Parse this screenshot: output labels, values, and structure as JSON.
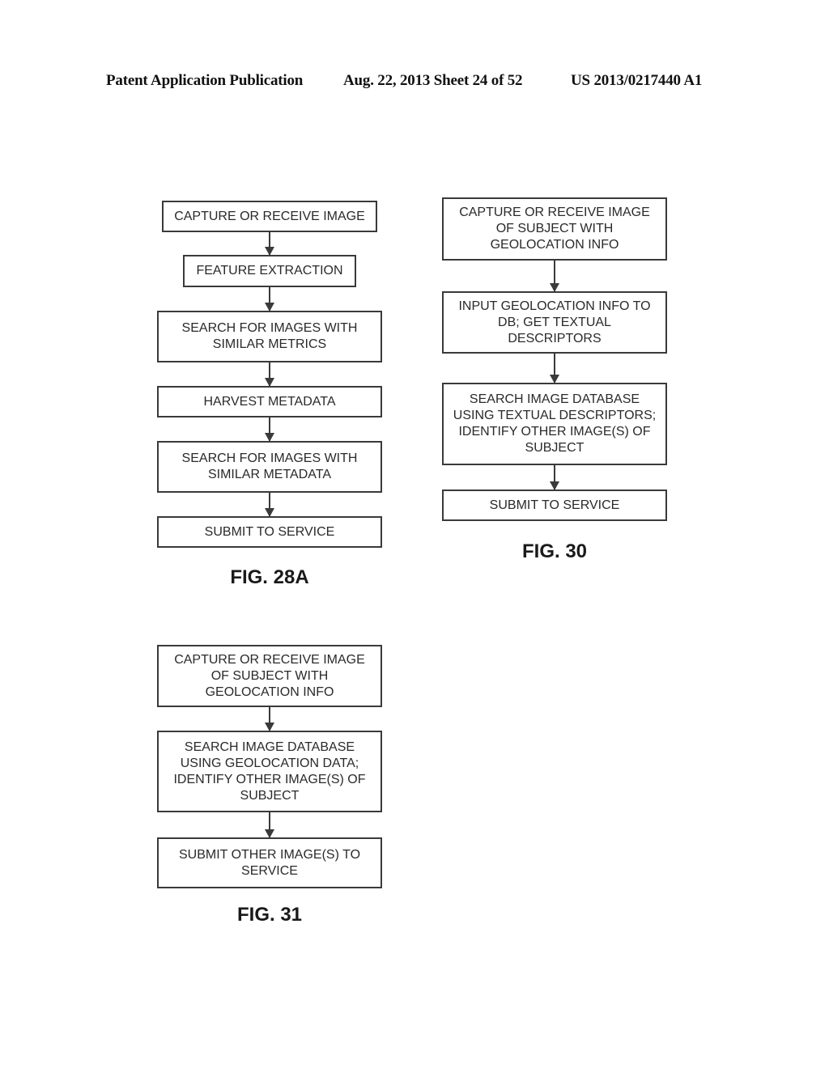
{
  "header": {
    "publication": "Patent Application Publication",
    "date_sheet": "Aug. 22, 2013  Sheet 24 of 52",
    "patent_number": "US 2013/0217440 A1"
  },
  "fig28a": {
    "label": "FIG. 28A",
    "steps": [
      "CAPTURE OR RECEIVE IMAGE",
      "FEATURE EXTRACTION",
      "SEARCH FOR IMAGES WITH\nSIMILAR METRICS",
      "HARVEST METADATA",
      "SEARCH FOR IMAGES WITH\nSIMILAR METADATA",
      "SUBMIT TO SERVICE"
    ]
  },
  "fig30": {
    "label": "FIG. 30",
    "steps": [
      "CAPTURE OR RECEIVE IMAGE\nOF SUBJECT WITH\nGEOLOCATION INFO",
      "INPUT GEOLOCATION INFO TO\nDB; GET TEXTUAL\nDESCRIPTORS",
      "SEARCH IMAGE DATABASE\nUSING TEXTUAL DESCRIPTORS;\nIDENTIFY OTHER IMAGE(S) OF\nSUBJECT",
      "SUBMIT TO SERVICE"
    ]
  },
  "fig31": {
    "label": "FIG. 31",
    "steps": [
      "CAPTURE OR RECEIVE IMAGE\nOF SUBJECT WITH\nGEOLOCATION INFO",
      "SEARCH IMAGE DATABASE\nUSING GEOLOCATION DATA;\nIDENTIFY OTHER IMAGE(S) OF\nSUBJECT",
      "SUBMIT OTHER IMAGE(S) TO\nSERVICE"
    ]
  }
}
